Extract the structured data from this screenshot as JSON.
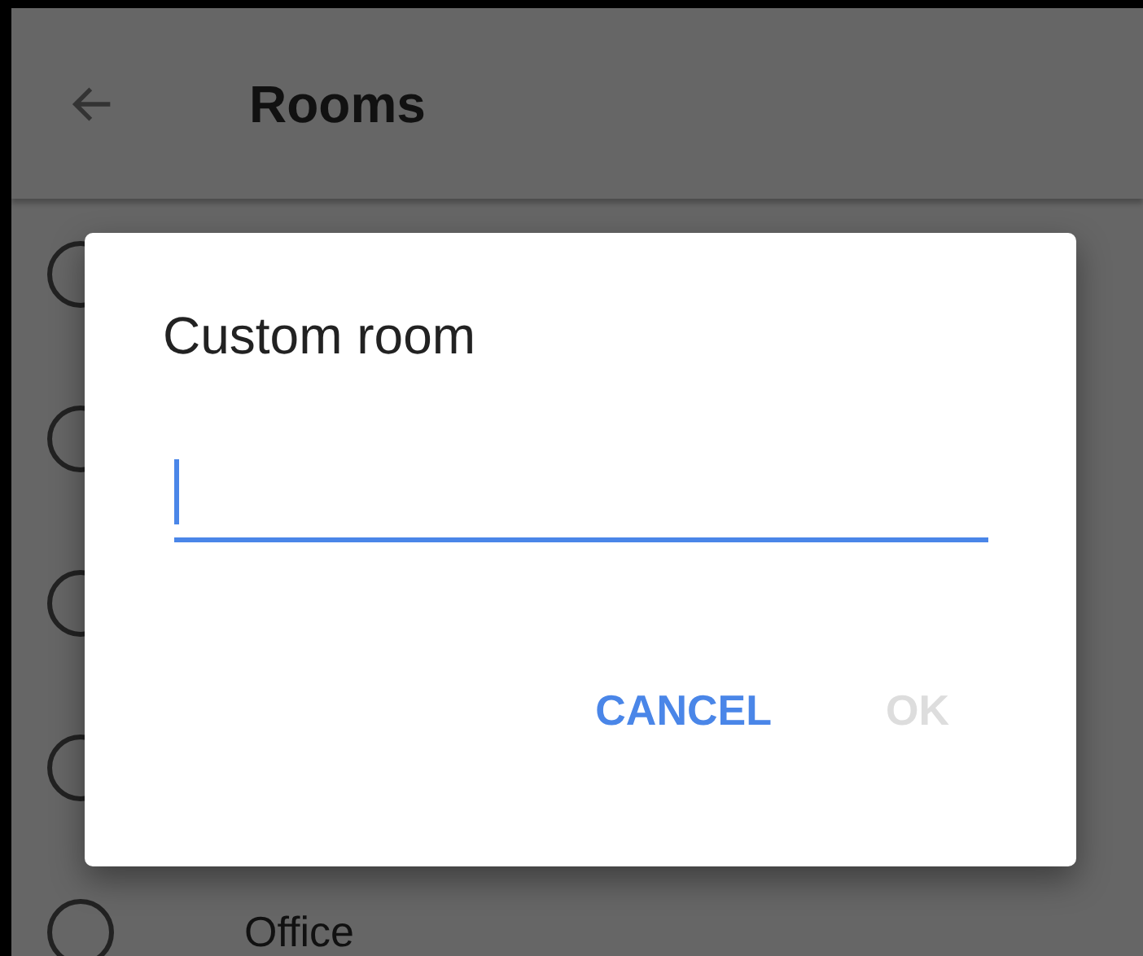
{
  "app_bar": {
    "title": "Rooms"
  },
  "rooms": [
    {
      "selected": false
    },
    {
      "selected": false
    },
    {
      "selected": false
    },
    {
      "selected": false
    },
    {
      "label": "Office",
      "selected": false
    }
  ],
  "dialog": {
    "title": "Custom room",
    "field": {
      "focused": true
    },
    "buttons": [
      {
        "label": "CANCEL",
        "disabled": false
      },
      {
        "label": "OK",
        "disabled": true
      }
    ]
  }
}
